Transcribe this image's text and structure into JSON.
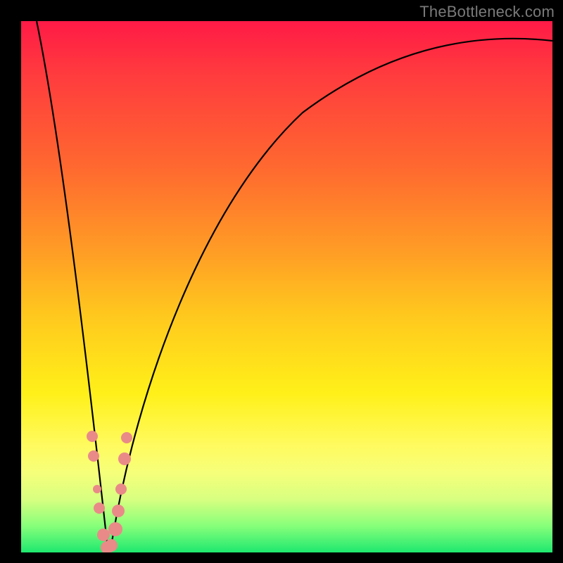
{
  "watermark": "TheBottleneck.com",
  "chart_data": {
    "type": "line",
    "title": "",
    "xlabel": "",
    "ylabel": "",
    "xlim": [
      0,
      100
    ],
    "ylim": [
      0,
      100
    ],
    "grid": false,
    "legend": false,
    "series": [
      {
        "name": "bottleneck-curve",
        "color": "#000000",
        "x": [
          3,
          5,
          7,
          9,
          11,
          13,
          14.5,
          15.5,
          16.5,
          17.5,
          19,
          21,
          24,
          28,
          33,
          40,
          48,
          58,
          70,
          85,
          100
        ],
        "y": [
          100,
          84,
          68,
          53,
          39,
          25,
          14,
          6,
          1,
          5,
          12,
          22,
          34,
          46,
          57,
          67,
          75,
          82,
          88,
          93,
          96
        ]
      }
    ],
    "markers": [
      {
        "name": "highlight-points",
        "color": "#e98a88",
        "radius_px": 7,
        "points": [
          {
            "x": 13.0,
            "y": 22
          },
          {
            "x": 13.3,
            "y": 18
          },
          {
            "x": 14.2,
            "y": 11
          },
          {
            "x": 14.6,
            "y": 8
          },
          {
            "x": 15.5,
            "y": 3
          },
          {
            "x": 16.0,
            "y": 1
          },
          {
            "x": 16.6,
            "y": 2
          },
          {
            "x": 17.6,
            "y": 4
          },
          {
            "x": 18.2,
            "y": 8
          },
          {
            "x": 18.6,
            "y": 12
          },
          {
            "x": 19.4,
            "y": 18
          },
          {
            "x": 19.8,
            "y": 22
          }
        ]
      }
    ]
  }
}
